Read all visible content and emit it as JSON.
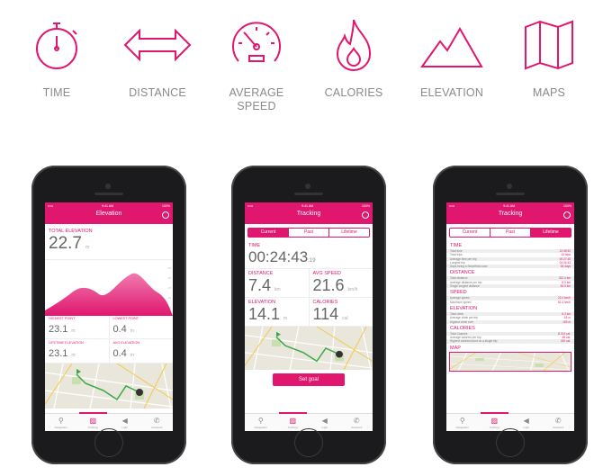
{
  "features": [
    {
      "icon": "stopwatch-icon",
      "label": "TIME"
    },
    {
      "icon": "double-arrow-icon",
      "label": "DISTANCE"
    },
    {
      "icon": "speedometer-icon",
      "label": "AVERAGE SPEED"
    },
    {
      "icon": "flame-icon",
      "label": "CALORIES"
    },
    {
      "icon": "mountain-icon",
      "label": "ELEVATION"
    },
    {
      "icon": "map-icon",
      "label": "MAPS"
    }
  ],
  "accent": "#e0166f",
  "status": {
    "carrier": "•••••",
    "time": "9:41 AM",
    "battery": "100%"
  },
  "tabbar": [
    "Navigation",
    "Tracking",
    "Light",
    "Assistant"
  ],
  "phone1": {
    "title": "Elevation",
    "total_label": "TOTAL ELEVATION",
    "total_value": "22.7",
    "unit": "m",
    "chart_ticks": [
      "25",
      "20",
      "15",
      "10",
      "5"
    ],
    "stats": [
      {
        "label": "HIGHEST POINT",
        "value": "23.1",
        "unit": "m"
      },
      {
        "label": "LOWEST POINT",
        "value": "0.4",
        "unit": "m"
      },
      {
        "label": "LIFETIME ELEVATION",
        "value": "23.1",
        "unit": "m"
      },
      {
        "label": "AVG ELEVATION",
        "value": "0.4",
        "unit": "m"
      }
    ]
  },
  "phone2": {
    "title": "Tracking",
    "segments": [
      "Current",
      "Past",
      "Lifetime"
    ],
    "time_label": "TIME",
    "time_value": "00:24:43",
    "time_fraction": ":19",
    "distance_label": "DISTANCE",
    "distance_value": "7.4",
    "distance_unit": "km",
    "speed_label": "AVG SPEED",
    "speed_value": "21.6",
    "speed_unit": "km/h",
    "elevation_label": "ELEVATION",
    "elevation_value": "14.1",
    "elevation_unit": "m",
    "calories_label": "CALORIES",
    "calories_value": "114",
    "calories_unit": "cal",
    "goal_button": "Set goal"
  },
  "phone3": {
    "title": "Tracking",
    "segments": [
      "Current",
      "Past",
      "Lifetime"
    ],
    "sections": [
      {
        "title": "TIME",
        "rows": [
          [
            "Total time",
            "12:45:52"
          ],
          [
            "Total trips",
            "43 trips"
          ],
          [
            "Average time per trip",
            "00:27:45"
          ],
          [
            "Longest trip",
            "04:34:43"
          ],
          [
            "Days being a SmartHalo user",
            "84 days"
          ]
        ]
      },
      {
        "title": "DISTANCE",
        "rows": [
          [
            "Total distance",
            "312.4 km"
          ],
          [
            "Average distance per trip",
            "8.5 km"
          ],
          [
            "Single longest distance",
            "84.5 km"
          ]
        ]
      },
      {
        "title": "SPEED",
        "rows": [
          [
            "Average speed",
            "22.4 km/h"
          ],
          [
            "Maximum speed",
            "61.4 km/h"
          ]
        ]
      },
      {
        "title": "ELEVATION",
        "rows": [
          [
            "Total climb",
            "8.3 km"
          ],
          [
            "Average climb per trip",
            "18 m"
          ],
          [
            "Highest climb ever",
            "153 m"
          ]
        ]
      },
      {
        "title": "CALORIES",
        "rows": [
          [
            "Total Calories",
            "8 214 cal."
          ],
          [
            "Average calories per trip",
            "65 cal."
          ],
          [
            "Highest calories burnt on a single trip",
            "249 cal."
          ]
        ]
      }
    ],
    "map_label": "MAP"
  }
}
